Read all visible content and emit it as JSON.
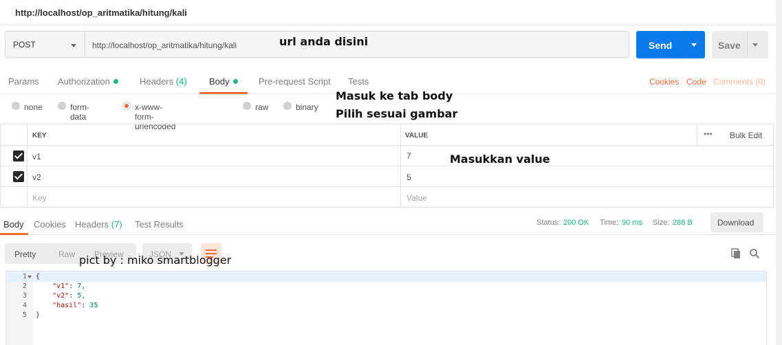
{
  "window": {
    "title": "http://localhost/op_aritmatika/hitung/kali"
  },
  "request": {
    "method": "POST",
    "url": "http://localhost/op_aritmatika/hitung/kali",
    "send_label": "Send",
    "save_label": "Save"
  },
  "annotations": {
    "url_note": "url anda disini",
    "body_tab_note": "Masuk ke tab body",
    "pick_note": "Pilih sesuai gambar",
    "value_note": "Masukkan value",
    "credit": "pict by : miko smartblogger"
  },
  "request_tabs": {
    "params": "Params",
    "authorization": "Authorization",
    "headers": "Headers",
    "headers_count": "(4)",
    "body": "Body",
    "prerequest": "Pre-request Script",
    "tests": "Tests",
    "cookies": "Cookies",
    "code": "Code",
    "comments": "Comments (0)"
  },
  "body_types": {
    "none": "none",
    "form_data": "form-data",
    "urlencoded": "x-www-form-urlencoded",
    "raw": "raw",
    "binary": "binary",
    "selected": "x-www-form-urlencoded"
  },
  "params_table": {
    "key_header": "KEY",
    "value_header": "VALUE",
    "more": "•••",
    "bulk_edit": "Bulk Edit",
    "rows": [
      {
        "key": "v1",
        "value": "7",
        "checked": true
      },
      {
        "key": "v2",
        "value": "5",
        "checked": true
      }
    ],
    "key_placeholder": "Key",
    "value_placeholder": "Value"
  },
  "response_tabs": {
    "body": "Body",
    "cookies": "Cookies",
    "headers": "Headers",
    "headers_count": "(7)",
    "test_results": "Test Results"
  },
  "response_meta": {
    "status_label": "Status:",
    "status": "200 OK",
    "time_label": "Time:",
    "time": "90 ms",
    "size_label": "Size:",
    "size": "288 B",
    "download": "Download"
  },
  "view": {
    "pretty": "Pretty",
    "raw": "Raw",
    "preview": "Preview",
    "format": "JSON"
  },
  "response_body": {
    "line_numbers": [
      "1",
      "2",
      "3",
      "4",
      "5"
    ],
    "lines": [
      {
        "text": "{"
      },
      {
        "key": "\"v1\"",
        "value": "7,"
      },
      {
        "key": "\"v2\"",
        "value": "5,"
      },
      {
        "key": "\"hasil\"",
        "value": "35"
      },
      {
        "text": "}"
      }
    ]
  },
  "colors": {
    "accent": "#f26b3a",
    "primary": "#097bed",
    "success": "#26b47f"
  }
}
